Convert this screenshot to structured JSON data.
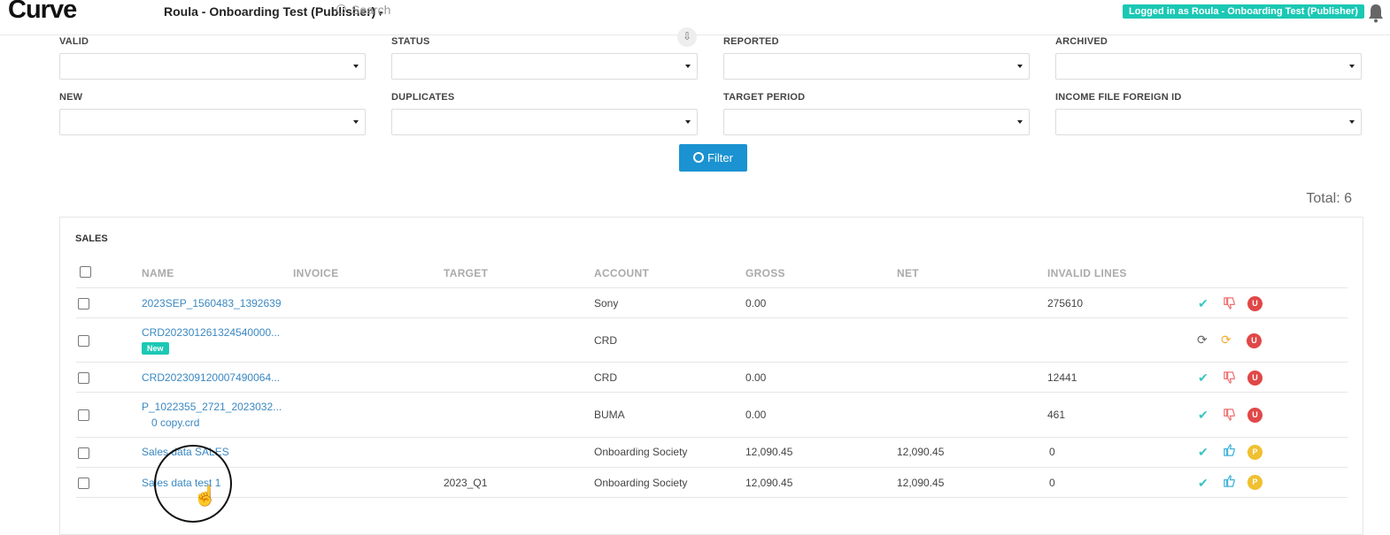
{
  "header": {
    "logo": "Curve",
    "app_title": "Roula - Onboarding Test (Publisher)",
    "search_placeholder": "Search",
    "login_badge": "Logged in as Roula - Onboarding Test (Publisher)"
  },
  "filters": [
    {
      "label": "VALID",
      "value": ""
    },
    {
      "label": "STATUS",
      "value": ""
    },
    {
      "label": "REPORTED",
      "value": ""
    },
    {
      "label": "ARCHIVED",
      "value": ""
    },
    {
      "label": "NEW",
      "value": ""
    },
    {
      "label": "DUPLICATES",
      "value": ""
    },
    {
      "label": "TARGET PERIOD",
      "value": ""
    },
    {
      "label": "INCOME FILE FOREIGN ID",
      "value": ""
    }
  ],
  "filter_button": "Filter",
  "total": "Total: 6",
  "table": {
    "title": "SALES",
    "columns": [
      "NAME",
      "INVOICE",
      "TARGET",
      "ACCOUNT",
      "GROSS",
      "NET",
      "INVALID LINES"
    ],
    "rows": [
      {
        "name": "2023SEP_1560483_1392639",
        "name2": "",
        "badge": "",
        "target": "",
        "account": "Sony",
        "gross": "0.00",
        "net": "",
        "invalid": "275610",
        "a1": "check",
        "a2": "thumb-down",
        "status": "U"
      },
      {
        "name": "CRD202301261324540000...",
        "name2": "",
        "badge": "New",
        "target": "",
        "account": "CRD",
        "gross": "",
        "net": "",
        "invalid": "",
        "a1": "refresh",
        "a2": "refresh-warning",
        "status": "U"
      },
      {
        "name": "CRD202309120007490064...",
        "name2": "",
        "badge": "",
        "target": "",
        "account": "CRD",
        "gross": "0.00",
        "net": "",
        "invalid": "12441",
        "a1": "check",
        "a2": "thumb-down",
        "status": "U"
      },
      {
        "name": "P_1022355_2721_2023032...",
        "name2": "0 copy.crd",
        "badge": "",
        "target": "",
        "account": "BUMA",
        "gross": "0.00",
        "net": "",
        "invalid": "461",
        "a1": "check",
        "a2": "thumb-down",
        "status": "U"
      },
      {
        "name": "Sales data SALES",
        "name2": "",
        "badge": "",
        "target": "",
        "account": "Onboarding Society",
        "gross": "12,090.45",
        "net": "12,090.45",
        "invalid": "0",
        "a1": "check",
        "a2": "thumb-up",
        "status": "P"
      },
      {
        "name": "Sales data test 1",
        "name2": "",
        "badge": "",
        "target": "2023_Q1",
        "account": "Onboarding Society",
        "gross": "12,090.45",
        "net": "12,090.45",
        "invalid": "0",
        "a1": "check",
        "a2": "thumb-up",
        "status": "P"
      }
    ]
  }
}
